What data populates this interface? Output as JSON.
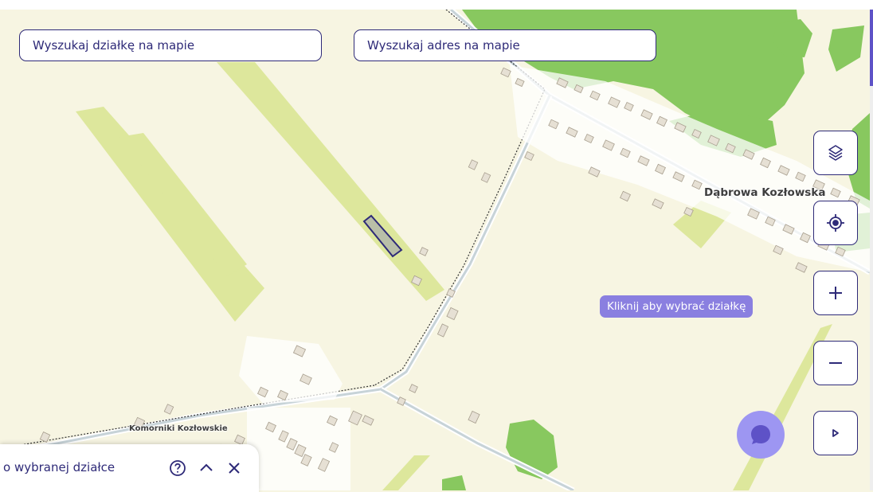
{
  "search": {
    "parcel_placeholder": "Wyszukaj działkę na mapie",
    "address_placeholder": "Wyszukaj adres na mapie"
  },
  "map": {
    "labels": {
      "dabrowa": "Dąbrowa Kozłowska",
      "komorniki": "Komorniki Kozłowskie"
    },
    "hint": "Kliknij aby wybrać działkę",
    "colors": {
      "background": "#f7f5e2",
      "field": "#dde79c",
      "forest": "#88c85f",
      "road": "#c7d3d8",
      "building": "#e6e0d4",
      "parcel_fill": "#b9bfa8",
      "parcel_stroke": "#2e2a78"
    }
  },
  "controls": {
    "layers_icon": "layers-icon",
    "locate_icon": "crosshair-icon",
    "zoom_in_icon": "plus-icon",
    "zoom_out_icon": "minus-icon",
    "expand_icon": "triangle-right-icon"
  },
  "chat": {
    "icon": "chat-bubble-icon",
    "color": "#9d96f2"
  },
  "panel": {
    "title": "o wybranej działce",
    "help_icon": "help-circle-icon",
    "collapse_icon": "chevron-up-icon",
    "close_icon": "close-icon"
  }
}
